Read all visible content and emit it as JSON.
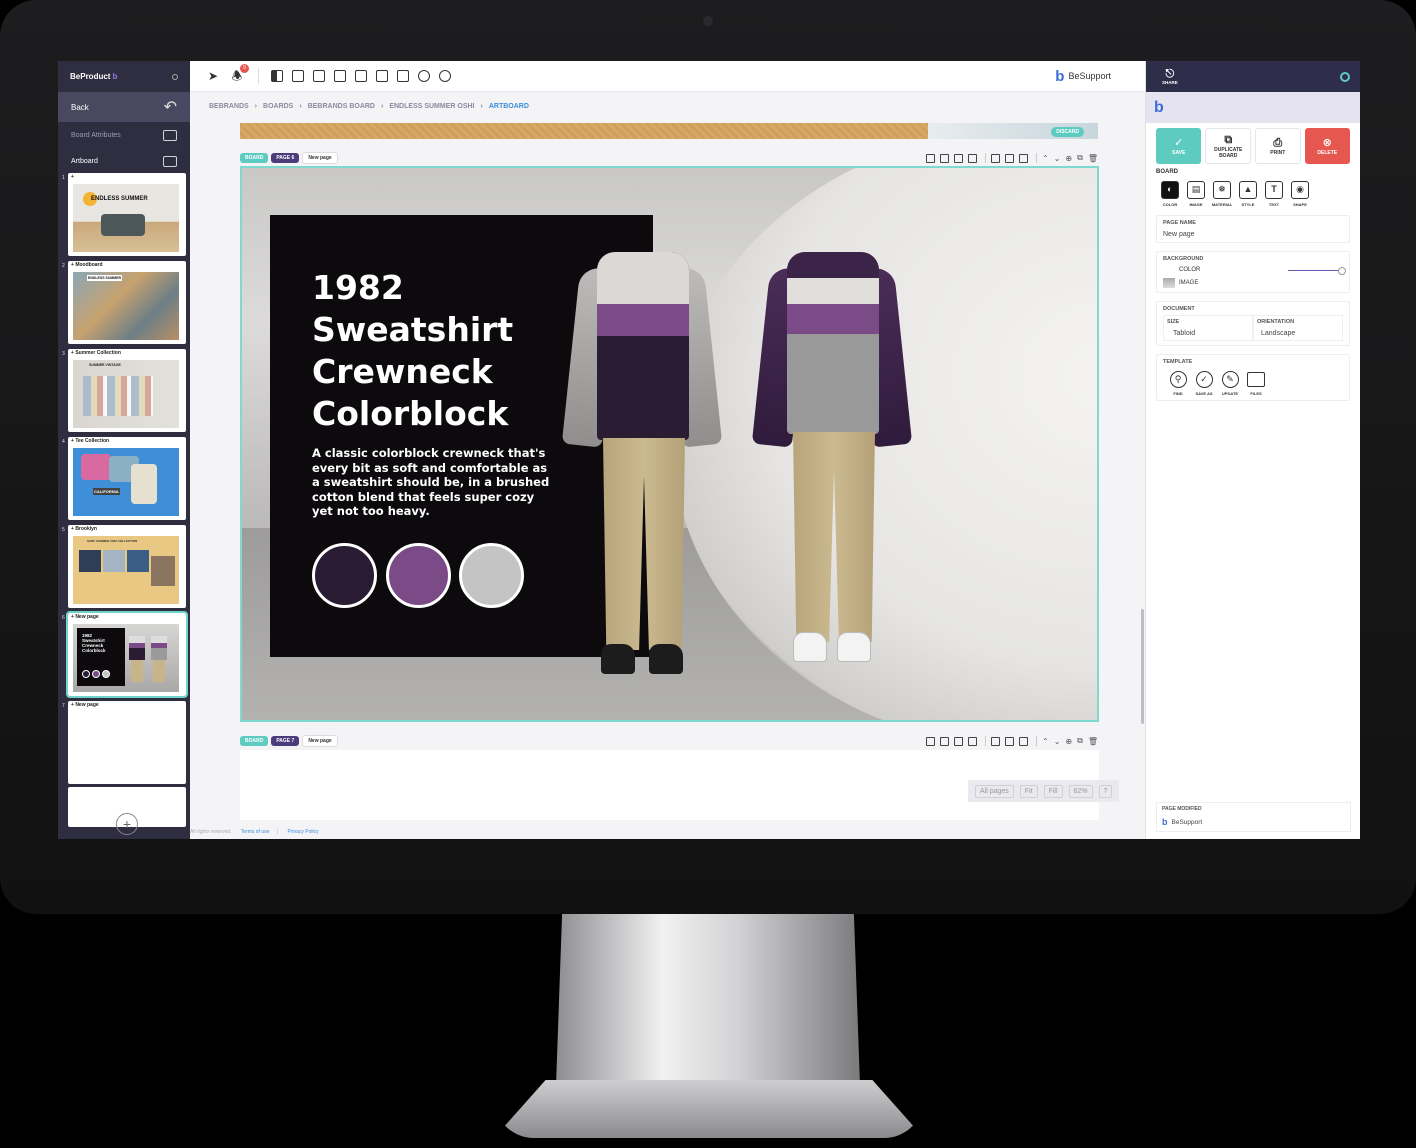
{
  "brand": {
    "name": "BeProduct",
    "logo_glyph": "b",
    "accent": "#5ecbc1",
    "sidebar_bg": "#2f2e40",
    "delete_color": "#e5574f"
  },
  "sidebar": {
    "back_label": "Back",
    "items": [
      {
        "label": "Board Attributes",
        "icon": "ellipsis-icon"
      },
      {
        "label": "Artboard",
        "icon": "page-icon"
      }
    ],
    "pages": [
      {
        "num": "1",
        "title": "",
        "selected": false
      },
      {
        "num": "2",
        "title": "Moodboard",
        "selected": false
      },
      {
        "num": "3",
        "title": "Summer Collection",
        "selected": false
      },
      {
        "num": "4",
        "title": "Tee Collection",
        "selected": false
      },
      {
        "num": "5",
        "title": "Brooklyn",
        "selected": false
      },
      {
        "num": "6",
        "title": "New page",
        "selected": true
      },
      {
        "num": "7",
        "title": "New page",
        "selected": false
      }
    ],
    "thumb_texts": {
      "p1": "ENDLESS SUMMER",
      "p2": "ENDLESS SUMMER",
      "p3": "SUMMER VINTAGE",
      "p4": "CALIFORNIA",
      "p5": "SURF SUMMER 2022 COLLECTION",
      "p6": "1982 Sweatshirt Crewneck Colorblock"
    }
  },
  "topbar": {
    "notification_count": "9",
    "user_name": "BeSupport"
  },
  "breadcrumb": [
    "BEBRANDS",
    "BOARDS",
    "BEBRANDS BOARD",
    "ENDLESS SUMMER OSHI",
    "ARTBOARD"
  ],
  "canvas": {
    "discard_label": "DISCARD",
    "page6": {
      "board_tag": "BOARD",
      "page_tag": "PAGE 6",
      "page_name": "New page",
      "headline": "1982 Sweatshirt Crewneck Colorblock",
      "description": "A classic colorblock crewneck that's every bit as soft and comfortable as a sweatshirt should be, in a brushed cotton blend that feels super cozy yet not too heavy.",
      "swatches": [
        "#2a1c33",
        "#7a4b86",
        "#c4c4c4"
      ]
    },
    "page7": {
      "board_tag": "BOARD",
      "page_tag": "PAGE 7",
      "page_name": "New page"
    },
    "zoom": {
      "all_pages": "All pages",
      "fit": "Fit",
      "fill": "Fill",
      "level": "62%",
      "help": "?"
    },
    "footer": {
      "rights": "All rights reserved.",
      "terms": "Terms of use",
      "sep": "|",
      "privacy": "Privacy Policy"
    }
  },
  "rightpanel": {
    "share_label": "SHARE",
    "actions": {
      "save": "SAVE",
      "duplicate": "DUPLICATE BOARD",
      "print": "PRINT",
      "delete": "DELETE"
    },
    "board_heading": "BOARD",
    "board_tools": [
      "COLOR",
      "IMAGE",
      "MATERIAL",
      "STYLE",
      "TEXT",
      "SHAPE"
    ],
    "page_name_label": "PAGE NAME",
    "page_name_value": "New page",
    "background_label": "BACKGROUND",
    "bg_color_label": "COLOR",
    "bg_image_label": "IMAGE",
    "document_label": "DOCUMENT",
    "size_label": "SIZE",
    "size_value": "Tabloid",
    "orientation_label": "ORIENTATION",
    "orientation_value": "Landscape",
    "template_label": "TEMPLATE",
    "template_tools": [
      "FIND",
      "SAVE AS",
      "UPDATE",
      "FILES"
    ],
    "page_modified_label": "PAGE MODIFIED",
    "page_modified_by": "BeSupport"
  }
}
